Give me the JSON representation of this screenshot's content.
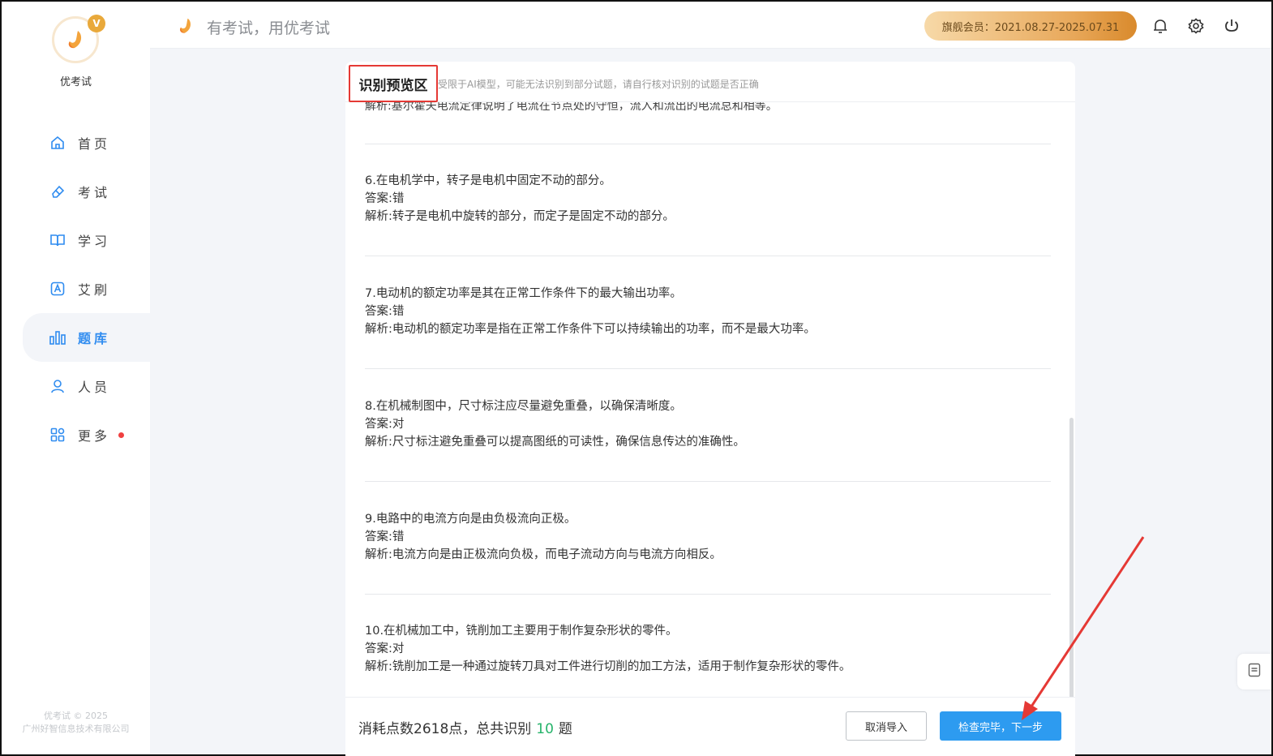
{
  "app": {
    "name": "优考试",
    "slogan": "有考试，用优考试",
    "copyright_line1": "优考试 © 2025",
    "copyright_line2": "广州好智信息技术有限公司",
    "member_badge": "旗舰会员：2021.08.27-2025.07.31",
    "brand_color": "#2f8cf0",
    "accent_color": "#e9a93b"
  },
  "sidebar": {
    "items": [
      {
        "label": "首页",
        "icon": "home-icon"
      },
      {
        "label": "考试",
        "icon": "eraser-icon"
      },
      {
        "label": "学习",
        "icon": "book-icon"
      },
      {
        "label": "艾刷",
        "icon": "letter-a-icon"
      },
      {
        "label": "题库",
        "icon": "bar-chart-icon",
        "active": true
      },
      {
        "label": "人员",
        "icon": "user-icon"
      },
      {
        "label": "更多",
        "icon": "apps-icon",
        "has_dot": true
      }
    ]
  },
  "header": {
    "icons": [
      "bell-icon",
      "gear-icon",
      "power-icon"
    ]
  },
  "preview": {
    "title": "识别预览区",
    "tip": "受限于AI模型，可能无法识别到部分试题，请自行核对识别的试题是否正确",
    "cut_line": "解析:基尔霍夫电流定律说明了电流在节点处的守恒，流入和流出的电流总和相等。",
    "questions": [
      {
        "question": "6.在电机学中，转子是电机中固定不动的部分。",
        "answer": "答案:错",
        "analysis": "解析:转子是电机中旋转的部分，而定子是固定不动的部分。"
      },
      {
        "question": "7.电动机的额定功率是其在正常工作条件下的最大输出功率。",
        "answer": "答案:错",
        "analysis": "解析:电动机的额定功率是指在正常工作条件下可以持续输出的功率，而不是最大功率。"
      },
      {
        "question": "8.在机械制图中，尺寸标注应尽量避免重叠，以确保清晰度。",
        "answer": "答案:对",
        "analysis": "解析:尺寸标注避免重叠可以提高图纸的可读性，确保信息传达的准确性。"
      },
      {
        "question": "9.电路中的电流方向是由负极流向正极。",
        "answer": "答案:错",
        "analysis": "解析:电流方向是由正极流向负极，而电子流动方向与电流方向相反。"
      },
      {
        "question": "10.在机械加工中，铣削加工主要用于制作复杂形状的零件。",
        "answer": "答案:对",
        "analysis": "解析:铣削加工是一种通过旋转刀具对工件进行切削的加工方法，适用于制作复杂形状的零件。"
      }
    ]
  },
  "footer": {
    "summary_prefix": "消耗点数2618点，总共识别",
    "count": "10",
    "summary_suffix": "题",
    "cancel_label": "取消导入",
    "next_label": "检查完毕，下一步",
    "next_color": "#2d9bf0"
  }
}
